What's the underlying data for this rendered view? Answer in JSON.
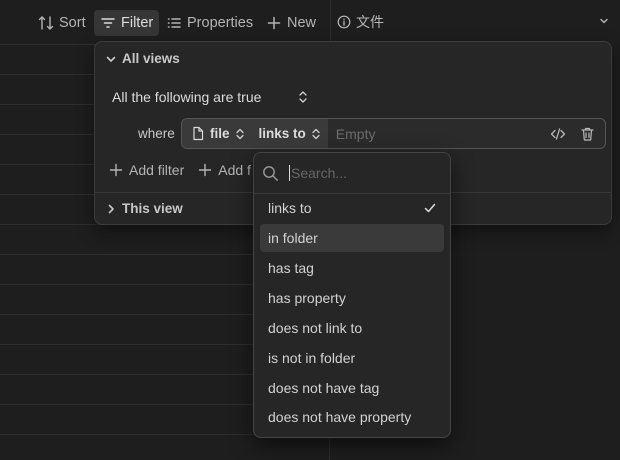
{
  "toolbar": {
    "sort_label": "Sort",
    "filter_label": "Filter",
    "properties_label": "Properties",
    "new_label": "New"
  },
  "column_header": {
    "label": "文件"
  },
  "filter_panel": {
    "all_views_label": "All views",
    "condition_label": "All the following are true",
    "where_label": "where",
    "rule": {
      "property": "file",
      "operator": "links to",
      "value_placeholder": "Empty"
    },
    "add_filter_label": "Add filter",
    "add_group_label": "Add f",
    "this_view_label": "This view"
  },
  "operator_menu": {
    "search_placeholder": "Search...",
    "selected_index": 0,
    "hovered_index": 1,
    "options": [
      "links to",
      "in folder",
      "has tag",
      "has property",
      "does not link to",
      "is not in folder",
      "does not have tag",
      "does not have property"
    ]
  },
  "colors": {
    "background": "#1e1e1e",
    "panel": "#262626",
    "text": "#dadada",
    "muted": "#b4b4b4",
    "hover": "#3a3a3a"
  }
}
